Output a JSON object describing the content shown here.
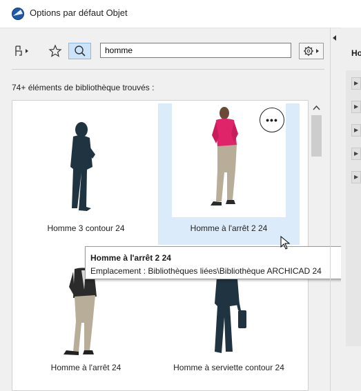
{
  "window": {
    "title": "Options par défaut Objet"
  },
  "toolbar": {
    "filter_icon": "hierarchy-arrow-icon",
    "favorite_icon": "star-icon",
    "search_icon": "magnifier-icon",
    "search_value": "homme",
    "settings_icon": "gear-arrow-icon"
  },
  "results": {
    "count_text": "74+ éléments de bibliothèque trouvés :"
  },
  "items": [
    {
      "label": "Homme 3 contour 24"
    },
    {
      "label": "Homme à l'arrêt 2 24"
    },
    {
      "label": "Homme à l'arrêt 24"
    },
    {
      "label": "Homme à serviette contour 24"
    }
  ],
  "more_button": "•••",
  "tooltip": {
    "title": "Homme à l'arrêt 2 24",
    "location": "Emplacement : Bibliothèques liées\\Bibliothèque ARCHICAD 24"
  },
  "right_panel": {
    "header": "Ho"
  },
  "colors": {
    "selection": "#dcebfa",
    "shirt": "#e0246a",
    "pants": "#b8ad98",
    "silhouette": "#1f3340"
  }
}
